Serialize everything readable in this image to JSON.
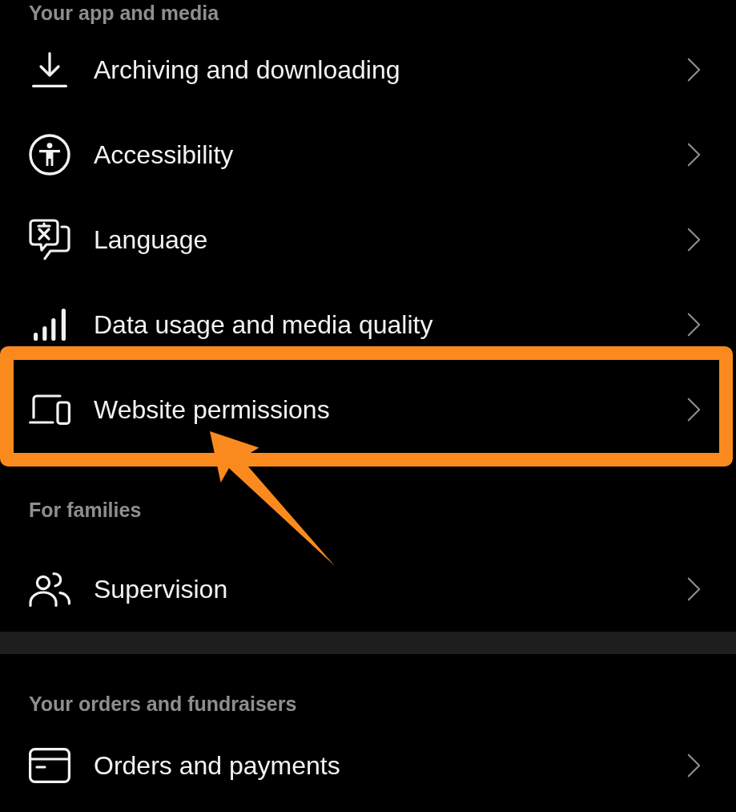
{
  "groups": [
    {
      "sections": [
        {
          "header": "Your app and media",
          "items": [
            {
              "label": "Archiving and downloading",
              "highlighted": false
            },
            {
              "label": "Accessibility",
              "highlighted": false
            },
            {
              "label": "Language",
              "highlighted": false
            },
            {
              "label": "Data usage and media quality",
              "highlighted": false
            },
            {
              "label": "Website permissions",
              "highlighted": true
            }
          ]
        },
        {
          "header": "For families",
          "items": [
            {
              "label": "Supervision",
              "highlighted": false
            }
          ]
        }
      ]
    },
    {
      "sections": [
        {
          "header": "Your orders and fundraisers",
          "items": [
            {
              "label": "Orders and payments",
              "highlighted": false
            }
          ]
        }
      ]
    }
  ]
}
